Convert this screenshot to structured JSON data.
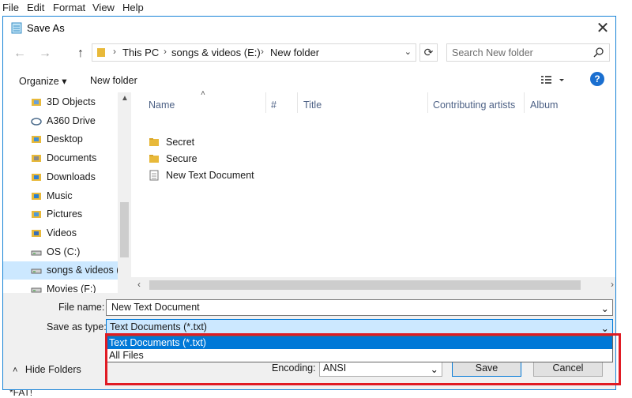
{
  "menubar": {
    "items": [
      "File",
      "Edit",
      "Format",
      "View",
      "Help"
    ]
  },
  "dialog": {
    "title": "Save As",
    "close": "✕"
  },
  "nav": {
    "back": "←",
    "forward": "→",
    "up": "↑",
    "breadcrumb": [
      "This PC",
      "songs & videos (E:)",
      "New folder"
    ],
    "refresh": "⟳",
    "search_placeholder": "Search New folder"
  },
  "toolbar": {
    "organize": "Organize ▾",
    "new_folder": "New folder",
    "help": "?"
  },
  "sidebar": {
    "items": [
      {
        "label": "3D Objects",
        "icon": "3d-objects-icon"
      },
      {
        "label": "A360 Drive",
        "icon": "cloud-drive-icon"
      },
      {
        "label": "Desktop",
        "icon": "desktop-folder-icon"
      },
      {
        "label": "Documents",
        "icon": "documents-folder-icon"
      },
      {
        "label": "Downloads",
        "icon": "downloads-folder-icon"
      },
      {
        "label": "Music",
        "icon": "music-folder-icon"
      },
      {
        "label": "Pictures",
        "icon": "pictures-folder-icon"
      },
      {
        "label": "Videos",
        "icon": "videos-folder-icon"
      },
      {
        "label": "OS (C:)",
        "icon": "drive-icon"
      },
      {
        "label": "songs & videos (",
        "icon": "drive-icon"
      },
      {
        "label": "Movies (F:)",
        "icon": "drive-icon"
      }
    ]
  },
  "filelist": {
    "columns": [
      "Name",
      "#",
      "Title",
      "Contributing artists",
      "Album"
    ],
    "files": [
      {
        "name": "Secret",
        "type": "folder"
      },
      {
        "name": "Secure",
        "type": "folder"
      },
      {
        "name": "New Text Document",
        "type": "text-file"
      }
    ]
  },
  "form": {
    "file_name_label": "File name:",
    "file_name_value": "New Text Document",
    "save_as_type_label": "Save as type:",
    "save_as_type_value": "Text Documents (*.txt)",
    "type_options": [
      "Text Documents (*.txt)",
      "All Files"
    ],
    "encoding_label": "Encoding:",
    "encoding_value": "ANSI",
    "save_button": "Save",
    "cancel_button": "Cancel",
    "hide_folders": "Hide Folders"
  },
  "background_text": "*FAT!",
  "colors": {
    "accent": "#0078d7",
    "selection": "#cce8ff",
    "highlight_box": "#e01b24",
    "folder": "#e8b93a"
  }
}
